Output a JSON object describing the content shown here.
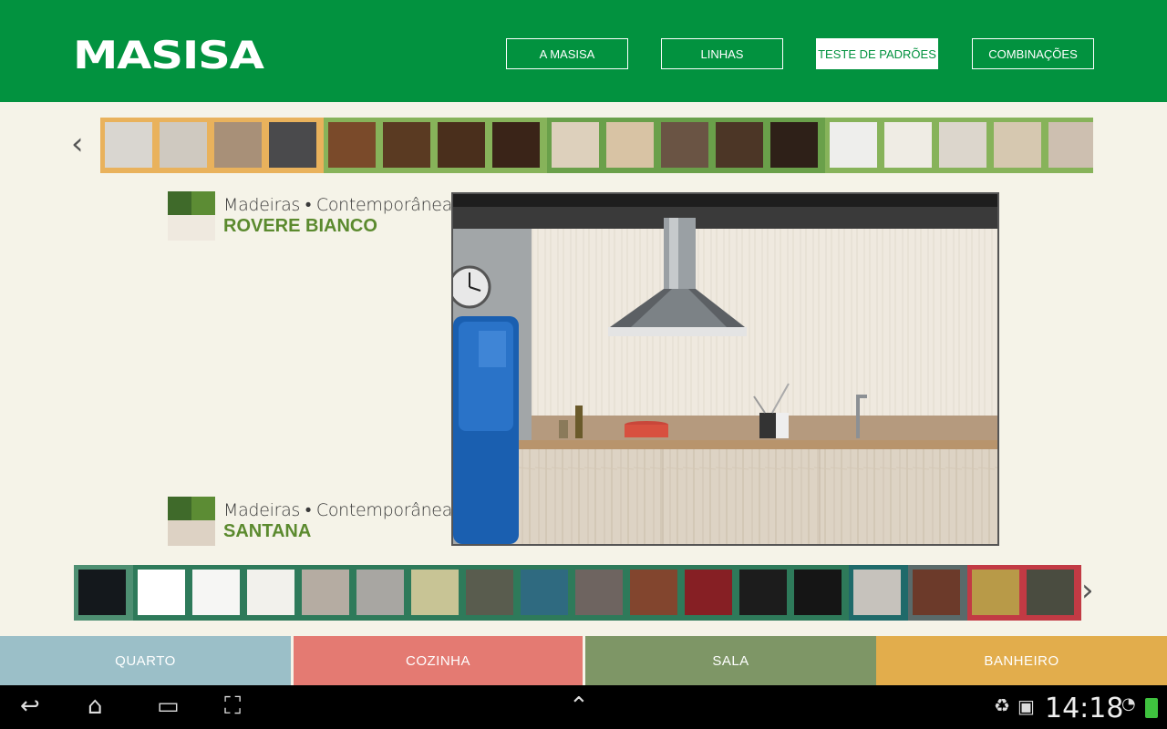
{
  "header": {
    "logo": "MASISA",
    "nav": [
      {
        "label": "A MASISA",
        "active": false
      },
      {
        "label": "LINHAS",
        "active": false
      },
      {
        "label": "TESTE DE PADRÕES",
        "active": true
      },
      {
        "label": "COMBINAÇÕES",
        "active": false
      }
    ]
  },
  "top_strip": {
    "prev_arrow": "‹",
    "groups": [
      {
        "frame": "#e9b25c",
        "swatches": [
          "#d9d6d0",
          "#cfc9c0",
          "#a89078",
          "#4a4a4c"
        ]
      },
      {
        "frame": "#87b35a",
        "swatches": [
          "#7a4a2a",
          "#5a3a22",
          "#4a2f1c",
          "#3a2418"
        ]
      },
      {
        "frame": "#6aa04a",
        "swatches": [
          "#ddd0bc",
          "#d8c3a4",
          "#6a5444",
          "#4c3626",
          "#2e2018"
        ]
      },
      {
        "frame": "#87b35a",
        "swatches": [
          "#eeeeec",
          "#efece4",
          "#dcd6cc",
          "#d6c8b0",
          "#cdbfb0"
        ]
      }
    ]
  },
  "labels": {
    "top": {
      "line": "Madeiras • Contemporâneas",
      "name": "ROVERE BIANCO",
      "c1": "#3f6a2a",
      "c2": "#5c8c34",
      "c3": "#efe9df"
    },
    "bottom": {
      "line": "Madeiras • Contemporâneas",
      "name": "SANTANA",
      "c1": "#3f6a2a",
      "c2": "#5c8c34",
      "c3": "#ddd2c4"
    }
  },
  "bottom_strip": {
    "next_arrow": "›",
    "groups": [
      {
        "frame": "#4e8f72",
        "swatches": [
          "#14181c"
        ]
      },
      {
        "frame": "#2e7a5a",
        "swatches": [
          "#ffffff",
          "#f6f6f4",
          "#f2f1ec",
          "#b5aca2",
          "#a8a6a2",
          "#c8c495",
          "#595c4e",
          "#2f6a80",
          "#6e6460",
          "#82452e",
          "#861f24",
          "#1c1c1c",
          "#151515"
        ]
      },
      {
        "frame": "#1f6a6a",
        "swatches": [
          "#c6c2bc"
        ]
      },
      {
        "frame": "#5a6a6a",
        "swatches": [
          "#6c3a2a"
        ]
      },
      {
        "frame": "#c23a44",
        "swatches": [
          "#b89a48",
          "#4a4c40"
        ]
      }
    ]
  },
  "categories": [
    {
      "label": "QUARTO",
      "color": "#9bbfc8"
    },
    {
      "label": "COZINHA",
      "color": "#e47a72"
    },
    {
      "label": "SALA",
      "color": "#7e9666"
    },
    {
      "label": "BANHEIRO",
      "color": "#e2ad4c"
    }
  ],
  "system": {
    "clock": "14:18",
    "back_icon": "↩",
    "home_icon": "⌂",
    "recent_icon": "▭",
    "screenshot_icon": "⛶",
    "up_icon": "⌃"
  }
}
